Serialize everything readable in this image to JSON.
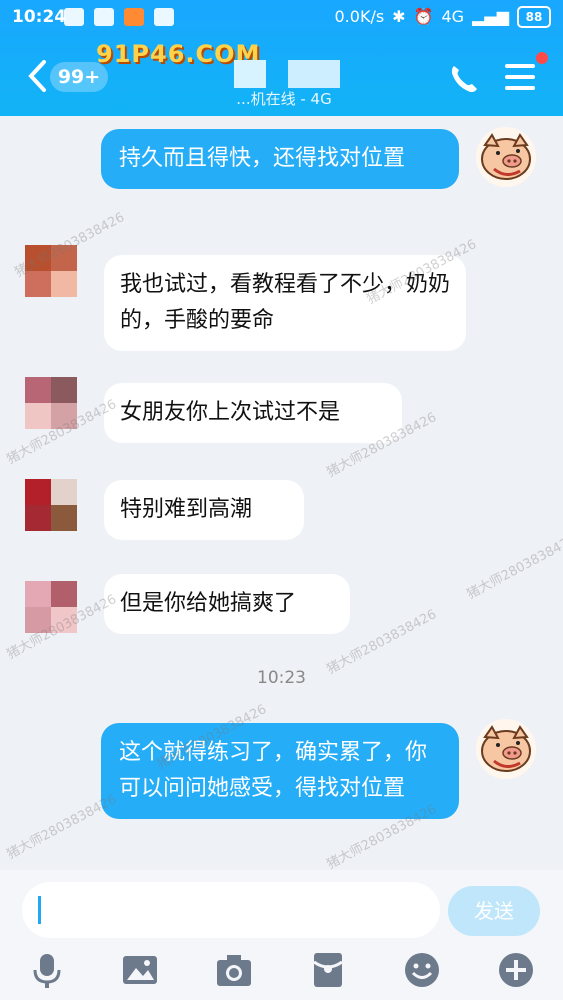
{
  "status_bar": {
    "time": "10:24",
    "speed": "0.0K/s",
    "network": "4G",
    "battery": "88"
  },
  "header": {
    "watermark": "91P46.COM",
    "unread_badge": "99+",
    "subtitle": "...机在线 - 4G"
  },
  "messages": [
    {
      "side": "out",
      "text": "持久而且得快，还得找对位置"
    },
    {
      "side": "in",
      "text": "我也试过，看教程看了不少，奶奶的，手酸的要命"
    },
    {
      "side": "in",
      "text": "女朋友你上次试过不是"
    },
    {
      "side": "in",
      "text": "特别难到高潮"
    },
    {
      "side": "in",
      "text": "但是你给她搞爽了"
    },
    {
      "side": "out",
      "text": "这个就得练习了，确实累了，你可以问问她感受，得找对位置"
    }
  ],
  "timestamp": "10:23",
  "input_bar": {
    "send_label": "发送"
  },
  "toolbar_icons": [
    "microphone-icon",
    "image-icon",
    "camera-icon",
    "red-packet-icon",
    "emoji-icon",
    "plus-icon"
  ],
  "watermarks": [
    "猪大师2803838426"
  ],
  "colors": {
    "header": "#19a7ff",
    "bubble_out": "#25adf7",
    "bubble_in": "#ffffff",
    "background": "#eef1f6"
  }
}
